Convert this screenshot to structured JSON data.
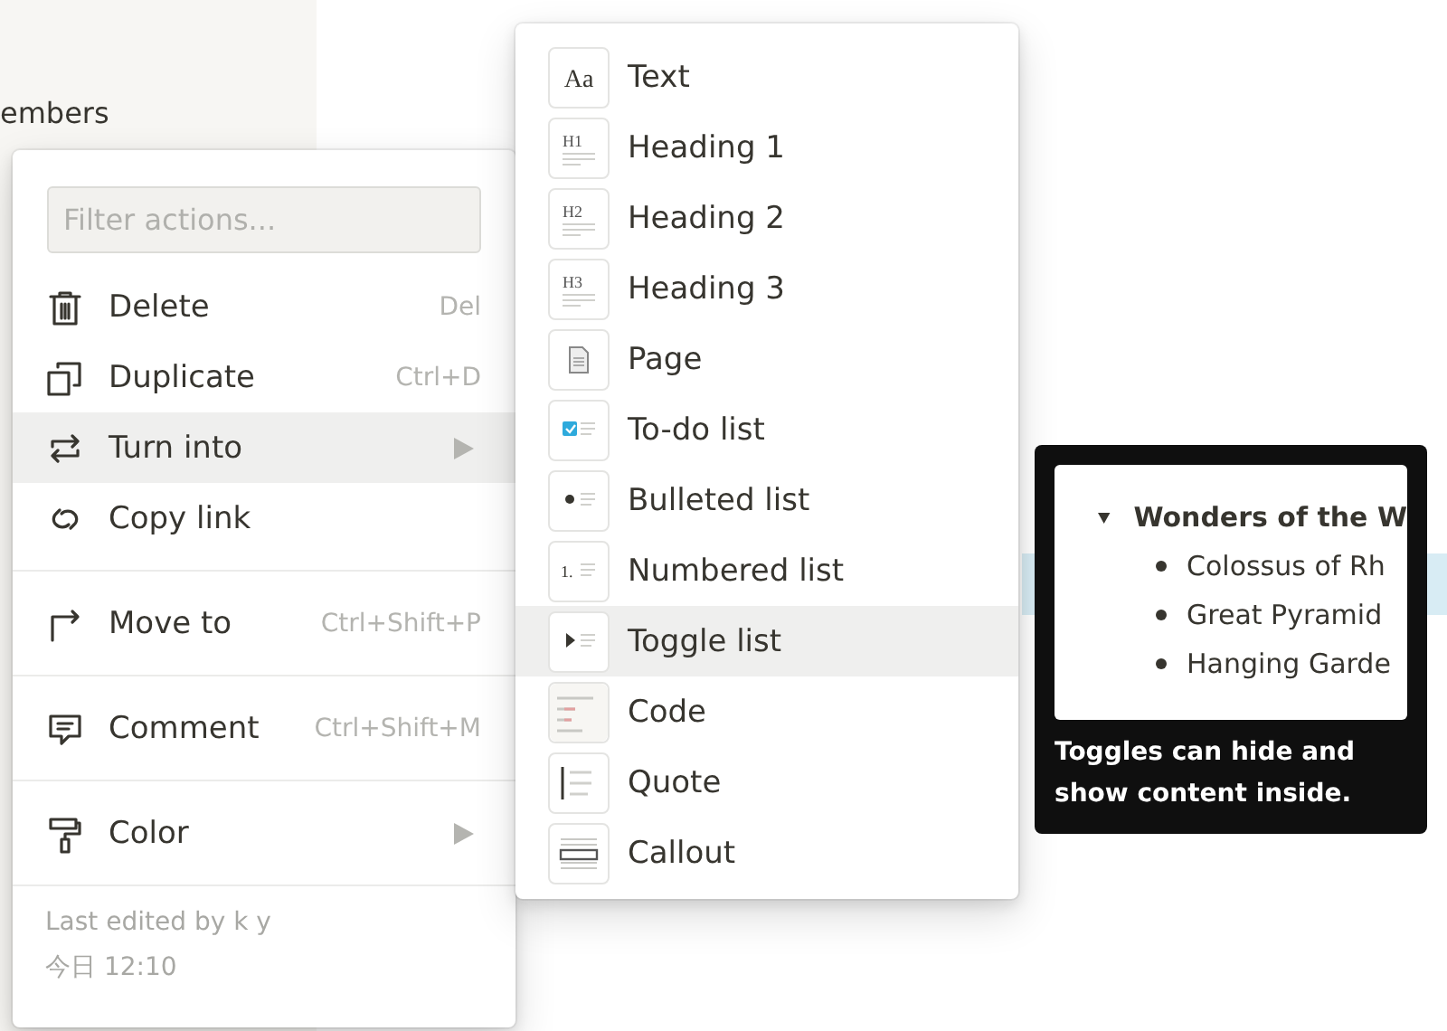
{
  "sidebar": {
    "partial_label": "embers"
  },
  "actions_menu": {
    "filter": {
      "placeholder": "Filter actions..."
    },
    "groups": [
      [
        {
          "label": "Delete",
          "kind": "trash",
          "shortcut": "Del",
          "submenu": false,
          "selected": false
        },
        {
          "label": "Duplicate",
          "kind": "duplicate",
          "shortcut": "Ctrl+D",
          "submenu": false,
          "selected": false
        },
        {
          "label": "Turn into",
          "kind": "turn",
          "submenu": true,
          "selected": true
        },
        {
          "label": "Copy link",
          "kind": "link",
          "submenu": false,
          "selected": false
        }
      ],
      [
        {
          "label": "Move to",
          "kind": "move",
          "shortcut": "Ctrl+Shift+P",
          "submenu": false,
          "selected": false
        }
      ],
      [
        {
          "label": "Comment",
          "kind": "comment",
          "shortcut": "Ctrl+Shift+M",
          "submenu": false,
          "selected": false
        }
      ],
      [
        {
          "label": "Color",
          "kind": "color",
          "submenu": true,
          "selected": false
        }
      ]
    ],
    "footer": {
      "edited_by": "Last edited by k y",
      "time": "今日 12:10"
    }
  },
  "turn_into_menu": [
    {
      "label": "Text",
      "kind": "text",
      "icon_text": "Aa",
      "selected": false
    },
    {
      "label": "Heading 1",
      "kind": "heading",
      "icon_text": "H1",
      "selected": false
    },
    {
      "label": "Heading 2",
      "kind": "heading",
      "icon_text": "H2",
      "selected": false
    },
    {
      "label": "Heading 3",
      "kind": "heading",
      "icon_text": "H3",
      "selected": false
    },
    {
      "label": "Page",
      "kind": "page",
      "selected": false
    },
    {
      "label": "To-do list",
      "kind": "todo",
      "selected": false
    },
    {
      "label": "Bulleted list",
      "kind": "bullet",
      "selected": false
    },
    {
      "label": "Numbered list",
      "kind": "numbered",
      "icon_text": "1.",
      "selected": false
    },
    {
      "label": "Toggle list",
      "kind": "toggle",
      "selected": true
    },
    {
      "label": "Code",
      "kind": "code",
      "selected": false
    },
    {
      "label": "Quote",
      "kind": "quote",
      "selected": false
    },
    {
      "label": "Callout",
      "kind": "callout",
      "selected": false
    }
  ],
  "tooltip": {
    "preview": {
      "heading": "Wonders of the W",
      "items": [
        "Colossus of Rh",
        "Great Pyramid",
        "Hanging Garde"
      ]
    },
    "text": "Toggles can hide and show content inside."
  }
}
